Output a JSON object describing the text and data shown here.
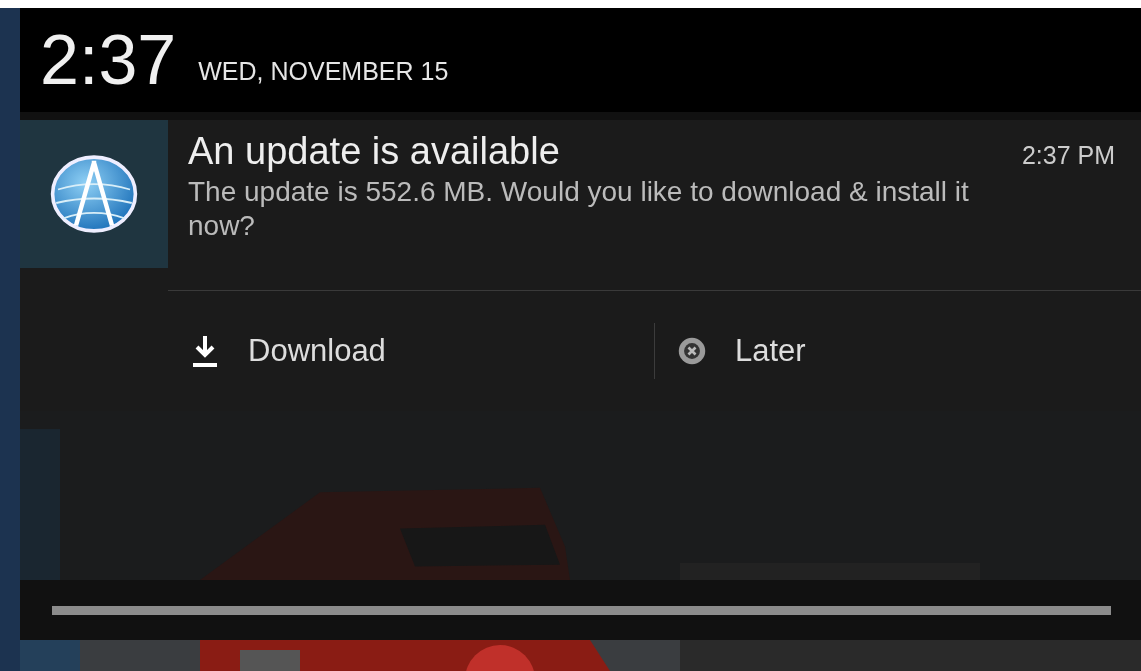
{
  "status_header": {
    "time": "2:37",
    "date": "WED, NOVEMBER 15"
  },
  "notification": {
    "title": "An update is available",
    "time": "2:37 PM",
    "message": "The update is 552.6 MB. Would you like to download & install it now?",
    "actions": [
      {
        "kind": "download",
        "label": "Download"
      },
      {
        "kind": "dismiss",
        "label": "Later"
      }
    ]
  }
}
